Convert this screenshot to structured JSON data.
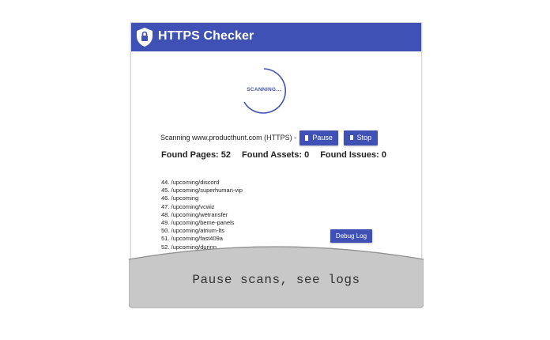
{
  "app": {
    "title": "HTTPS Checker",
    "accent_color": "#3f51b5",
    "icon": "shield-lock-icon"
  },
  "spinner": {
    "label": "SCANNING..."
  },
  "status": {
    "text": "Scanning www.producthunt.com (HTTPS) -",
    "pause_label": "Pause",
    "stop_label": "Stop"
  },
  "stats": {
    "pages": "Found Pages: 52",
    "assets": "Found Assets: 0",
    "issues": "Found Issues: 0"
  },
  "log": {
    "items": [
      "44. /upcoming/discord",
      "45. /upcoming/superhuman-vip",
      "46. /upcoming",
      "47. /upcoming/vcwiz",
      "48. /upcoming/wetransfer",
      "49. /upcoming/beme-panels",
      "50. /upcoming/atrium-lts",
      "51. /upcoming/fast409a",
      "52. /upcoming/durinn"
    ],
    "debug_label": "Debug Log"
  },
  "banner": {
    "caption": "Pause scans, see logs"
  }
}
